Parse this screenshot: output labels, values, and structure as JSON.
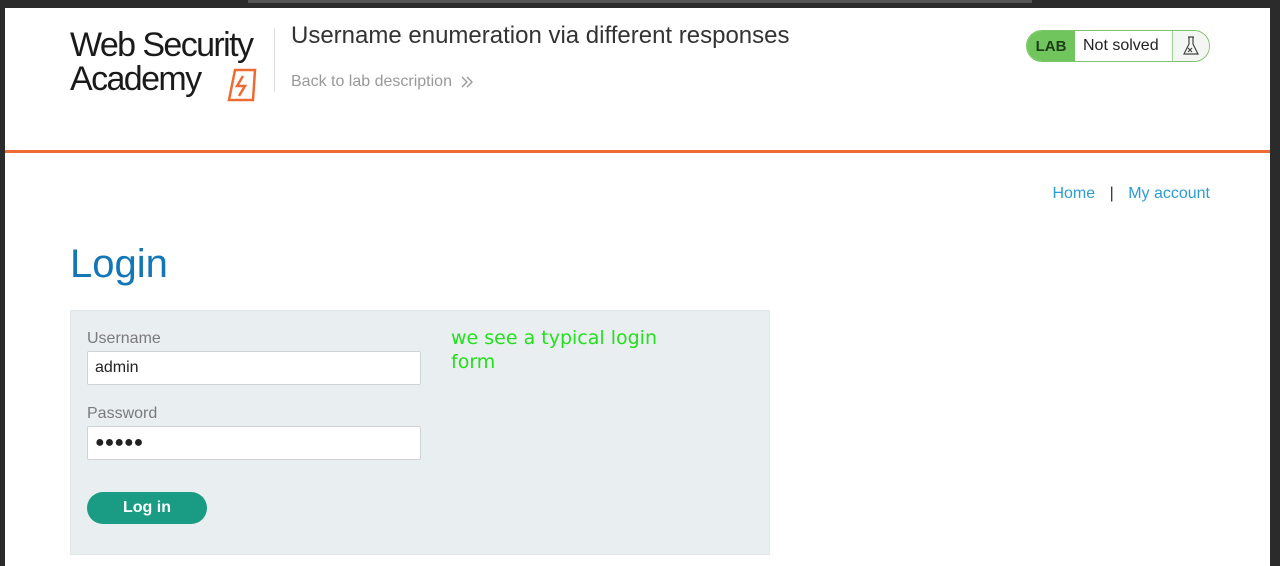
{
  "header": {
    "logo_line1": "Web Security",
    "logo_line2": "Academy",
    "lab_title": "Username enumeration via different responses",
    "back_link": "Back to lab description",
    "badge": {
      "label": "LAB",
      "status": "Not solved"
    }
  },
  "nav": {
    "home": "Home",
    "separator": "|",
    "account": "My account"
  },
  "main": {
    "heading": "Login",
    "username_label": "Username",
    "username_value": "admin",
    "password_label": "Password",
    "password_value": "●●●●●",
    "login_button": "Log in",
    "annotation": "we see a typical login form"
  },
  "colors": {
    "accent": "#ee6a33",
    "heading": "#1376b7",
    "button": "#1a9b83",
    "badge": "#70c65d",
    "annotation": "#22e01c"
  }
}
